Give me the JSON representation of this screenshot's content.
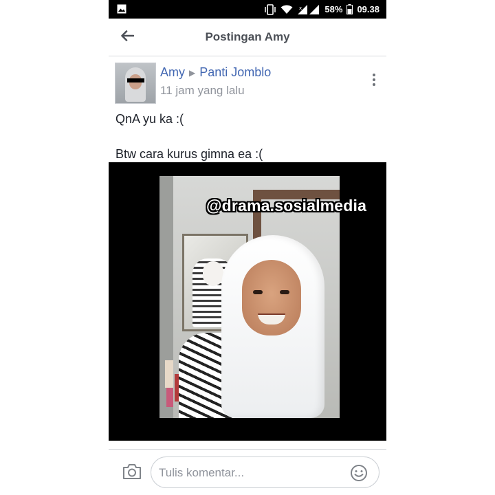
{
  "status_bar": {
    "battery_percent": "58%",
    "time": "09.38",
    "icons": [
      "image-icon",
      "vibrate-icon",
      "wifi-icon",
      "signal-icon",
      "battery-icon"
    ]
  },
  "header": {
    "title": "Postingan Amy",
    "back_icon": "arrow-left-icon"
  },
  "post": {
    "author": "Amy",
    "group": "Panti Jomblo",
    "time": "11 jam yang lalu",
    "menu_icon": "vertical-dots-icon",
    "lines": [
      "QnA yu ka :(",
      "Btw cara kurus gimna ea :("
    ],
    "watermark": "@drama.sosialmedia"
  },
  "comment_bar": {
    "camera_icon": "camera-icon",
    "placeholder": "Tulis komentar...",
    "emoji_icon": "smiley-icon"
  },
  "colors": {
    "link": "#4267b2",
    "muted": "#90949c",
    "text": "#1d2129",
    "header_title": "#4b4f56"
  }
}
